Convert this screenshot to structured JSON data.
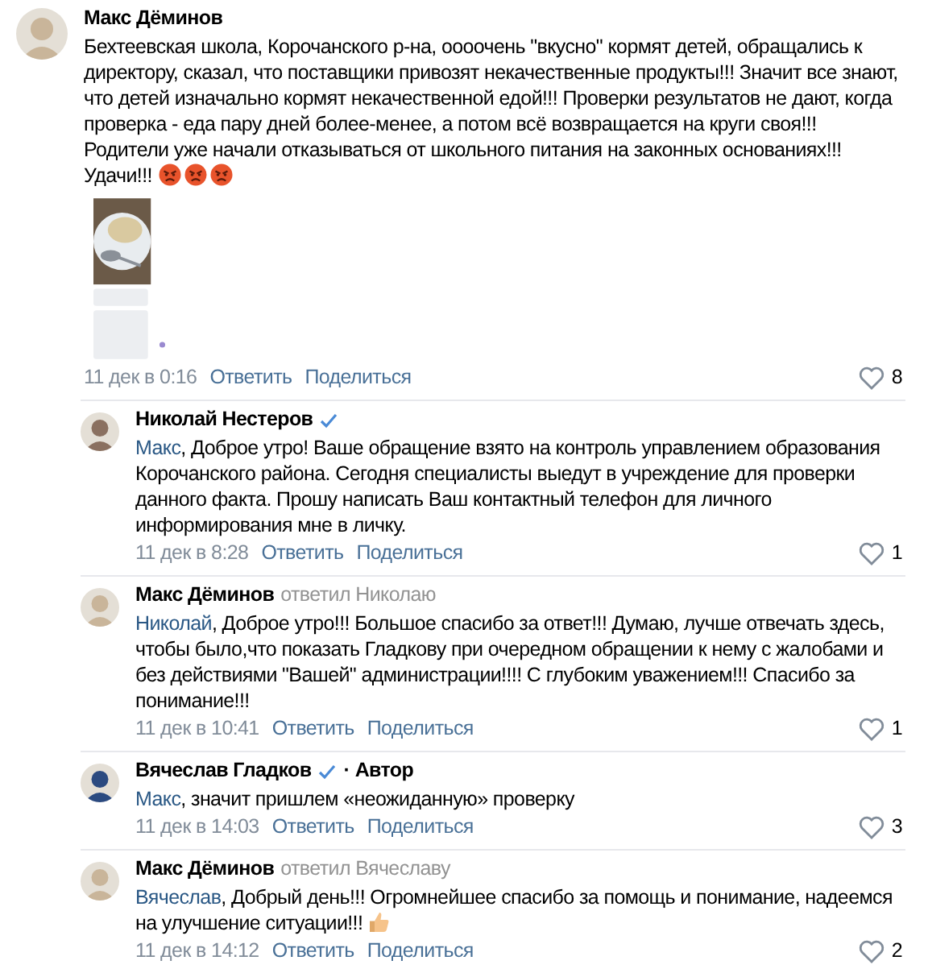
{
  "comments": [
    {
      "kind": "comment",
      "author": "Макс Дёминов",
      "verified": false,
      "text": "Бехтеевская школа, Корочанского р-на, оооочень \"вкусно\" кормят детей, обращались к директору, сказал, что поставщики привозят некачественные продукты!!! Значит все знают, что детей изначально кормят некачественной едой!!! Проверки результатов не дают, когда проверка - еда пару дней более-менее, а потом всё возвращается на круги своя!!! Родители уже начали отказываться от школьного питания на законных основаниях!!! Удачи!!!",
      "emojis": [
        {
          "kind": "angry"
        },
        {
          "kind": "angry"
        },
        {
          "kind": "angry"
        }
      ],
      "date": "11 дек в 0:16",
      "reply_label": "Ответить",
      "share_label": "Поделиться",
      "likes": "8"
    },
    {
      "kind": "reply",
      "author": "Николай Нестеров",
      "verified": true,
      "mention": "Макс",
      "text": ", Доброе утро! Ваше обращение взято на контроль управлением образования Корочанского района. Сегодня специалисты выедут в учреждение для проверки данного факта. Прошу написать Ваш контактный телефон для личного информирования мне в личку.",
      "date": "11 дек в 8:28",
      "reply_label": "Ответить",
      "share_label": "Поделиться",
      "likes": "1"
    },
    {
      "kind": "reply",
      "author": "Макс Дёминов",
      "verified": false,
      "replied_to": "ответил Николаю",
      "mention": "Николай",
      "text": ", Доброе утро!!! Большое спасибо за ответ!!! Думаю, лучше отвечать здесь, чтобы было,что показать Гладкову при очередном обращении к нему с жалобами и без действиями \"Вашей\" администрации!!!! С глубоким уважением!!! Спасибо за понимание!!!",
      "date": "11 дек в 10:41",
      "reply_label": "Ответить",
      "share_label": "Поделиться",
      "likes": "1"
    },
    {
      "kind": "reply",
      "author": "Вячеслав Гладков",
      "verified": true,
      "role": "· Автор",
      "mention": "Макс",
      "text": ", значит пришлем «неожиданную» проверку",
      "date": "11 дек в 14:03",
      "reply_label": "Ответить",
      "share_label": "Поделиться",
      "likes": "3"
    },
    {
      "kind": "reply",
      "author": "Макс Дёминов",
      "verified": false,
      "replied_to": "ответил Вячеславу",
      "mention": "Вячеслав",
      "text": ", Добрый день!!! Огромнейшее спасибо за помощь и понимание, надеемся на улучшение ситуации!!!",
      "emojis": [
        {
          "kind": "thumbs_up"
        }
      ],
      "date": "11 дек в 14:12",
      "reply_label": "Ответить",
      "share_label": "Поделиться",
      "likes": "2"
    }
  ]
}
